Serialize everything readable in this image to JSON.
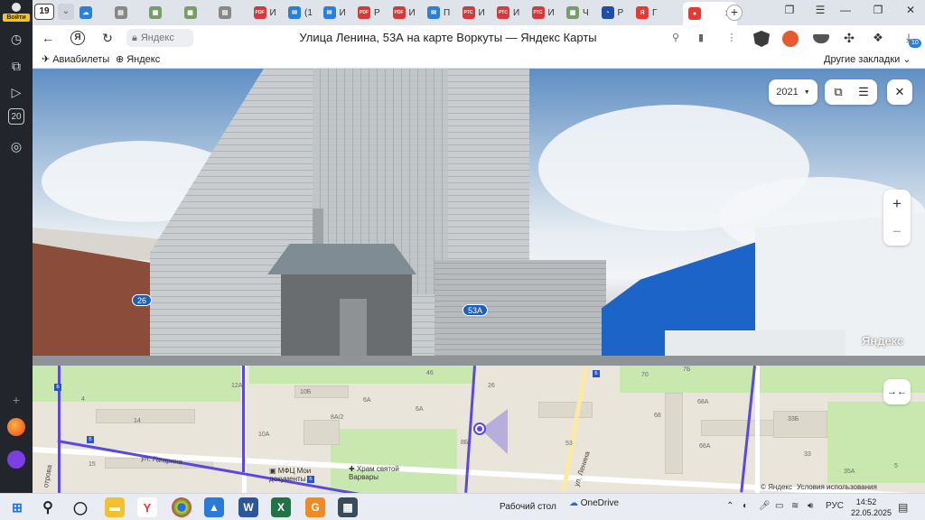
{
  "sidebar": {
    "login_label": "Войти",
    "items": [
      {
        "icon": "history-icon",
        "glyph": "◷"
      },
      {
        "icon": "collections-icon",
        "glyph": "⧉"
      },
      {
        "icon": "video-icon",
        "glyph": "▷"
      },
      {
        "icon": "counter-icon",
        "glyph": "20"
      },
      {
        "icon": "screenshot-icon",
        "glyph": "◎"
      },
      {
        "icon": "add-icon",
        "glyph": "+"
      }
    ]
  },
  "tabs": {
    "counter": "19",
    "items": [
      {
        "icon": "cloud-icon",
        "color": "#2a7fd8",
        "letter": "☁",
        "label": ""
      },
      {
        "icon": "doc-icon",
        "color": "#888888",
        "letter": "▤",
        "label": ""
      },
      {
        "icon": "image-icon",
        "color": "#7a9c6a",
        "letter": "▦",
        "label": ""
      },
      {
        "icon": "image-icon",
        "color": "#7a9c6a",
        "letter": "▦",
        "label": ""
      },
      {
        "icon": "doc-icon",
        "color": "#888888",
        "letter": "▤",
        "label": ""
      },
      {
        "icon": "pdf-icon",
        "color": "#d23b3b",
        "letter": "PDF",
        "label": "И"
      },
      {
        "icon": "mail-icon",
        "color": "#2a7fd8",
        "letter": "✉",
        "label": "(1"
      },
      {
        "icon": "mail-icon",
        "color": "#2a7fd8",
        "letter": "✉",
        "label": "И"
      },
      {
        "icon": "pdf-icon",
        "color": "#d23b3b",
        "letter": "PDF",
        "label": "Р"
      },
      {
        "icon": "pdf-icon",
        "color": "#d23b3b",
        "letter": "PDF",
        "label": "И"
      },
      {
        "icon": "mail-icon",
        "color": "#2a7fd8",
        "letter": "✉",
        "label": "П"
      },
      {
        "icon": "rts-icon",
        "color": "#d23b3b",
        "letter": "РТС",
        "label": "И"
      },
      {
        "icon": "rts-icon",
        "color": "#d23b3b",
        "letter": "РТС",
        "label": "И"
      },
      {
        "icon": "rts-icon",
        "color": "#d23b3b",
        "letter": "РТС",
        "label": "И"
      },
      {
        "icon": "image-icon",
        "color": "#7a9c6a",
        "letter": "▦",
        "label": "Ч"
      },
      {
        "icon": "globe-icon",
        "color": "#1f4ea8",
        "letter": "◔",
        "label": "Р"
      },
      {
        "icon": "yandex-icon",
        "color": "#e53935",
        "letter": "Я",
        "label": "Г"
      }
    ],
    "active": {
      "icon": "map-pin-icon",
      "color": "#e53935",
      "close": "✕"
    },
    "new_tab": "+"
  },
  "addressbar": {
    "domain": "Яндекс",
    "title": "Улица Ленина, 53А на карте Воркуты — Яндекс Карты",
    "download_badge": "10"
  },
  "bookmarks": {
    "items": [
      {
        "icon": "plane-icon",
        "glyph": "✈",
        "label": "Авиабилеты"
      },
      {
        "icon": "yandex-plus-icon",
        "glyph": "⊕",
        "label": "Яндекс"
      }
    ],
    "other": "Другие закладки"
  },
  "panorama": {
    "year": "2021",
    "house_badges": [
      "26",
      "53А"
    ],
    "watermark": "Яндекс"
  },
  "map": {
    "house_numbers": [
      "12А",
      "10Б",
      "6А",
      "8А/2",
      "6А",
      "14",
      "10А",
      "8Б",
      "53",
      "46",
      "26",
      "68",
      "68А",
      "66А",
      "33Б",
      "33",
      "35А",
      "70",
      "4",
      "15",
      "5",
      "7Б"
    ],
    "streets": [
      "ул. Гагарина",
      "ул. Ленина",
      "отрова"
    ],
    "pois": [
      {
        "name": "МФЦ Мои документы"
      },
      {
        "name": "Храм святой Варвары"
      }
    ],
    "copyright": "© Яндекс",
    "terms": "Условия использования"
  },
  "taskbar": {
    "desktop_label": "Рабочий стол",
    "onedrive_label": "OneDrive",
    "lang": "РУС",
    "time": "14:52",
    "date": "22.05.2025"
  }
}
